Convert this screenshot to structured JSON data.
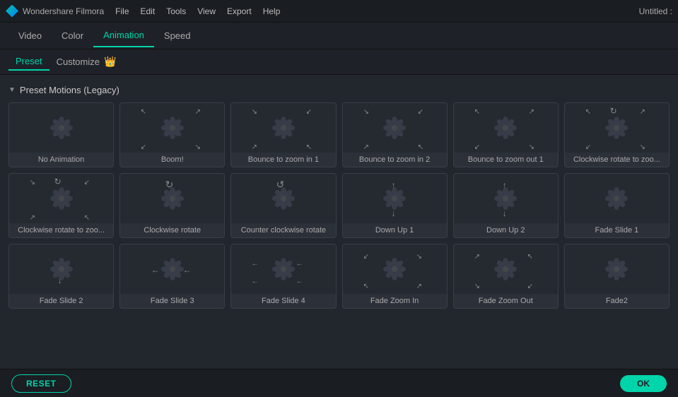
{
  "titleBar": {
    "appName": "Wondershare Filmora",
    "windowTitle": "Untitled :",
    "menus": [
      "File",
      "Edit",
      "Tools",
      "View",
      "Export",
      "Help"
    ]
  },
  "tabs": [
    {
      "label": "Video",
      "active": false
    },
    {
      "label": "Color",
      "active": false
    },
    {
      "label": "Animation",
      "active": true
    },
    {
      "label": "Speed",
      "active": false
    }
  ],
  "subTabs": [
    {
      "label": "Preset",
      "active": true
    },
    {
      "label": "Customize",
      "active": false
    }
  ],
  "crownIcon": "👑",
  "sectionLabel": "Preset Motions (Legacy)",
  "cards": [
    {
      "label": "No Animation",
      "arrowType": "none"
    },
    {
      "label": "Boom!",
      "arrowType": "outward"
    },
    {
      "label": "Bounce to zoom in 1",
      "arrowType": "inward"
    },
    {
      "label": "Bounce to zoom in 2",
      "arrowType": "inward"
    },
    {
      "label": "Bounce to zoom out 1",
      "arrowType": "outward"
    },
    {
      "label": "Clockwise rotate to zoo...",
      "arrowType": "rotate-out"
    },
    {
      "label": "Clockwise rotate to zoo...",
      "arrowType": "rotate-in"
    },
    {
      "label": "Clockwise rotate",
      "arrowType": "rotate"
    },
    {
      "label": "Counter clockwise rotate",
      "arrowType": "rotate-ccw"
    },
    {
      "label": "Down Up 1",
      "arrowType": "downup"
    },
    {
      "label": "Down Up 2",
      "arrowType": "downup"
    },
    {
      "label": "Fade Slide 1",
      "arrowType": "fade"
    },
    {
      "label": "Fade Slide 2",
      "arrowType": "fade-down"
    },
    {
      "label": "Fade Slide 3",
      "arrowType": "fade-left"
    },
    {
      "label": "Fade Slide 4",
      "arrowType": "fade-left2"
    },
    {
      "label": "Fade Zoom In",
      "arrowType": "fade-zoomin"
    },
    {
      "label": "Fade Zoom Out",
      "arrowType": "fade-zoomout"
    },
    {
      "label": "Fade2",
      "arrowType": "fade"
    }
  ],
  "buttons": {
    "reset": "RESET",
    "ok": "OK"
  }
}
